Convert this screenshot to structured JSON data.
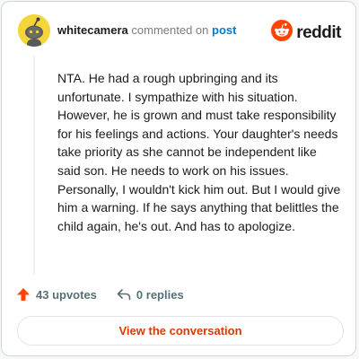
{
  "header": {
    "username": "whitecamera",
    "action_text": "commented on",
    "link_text": "post",
    "brand_name": "reddit",
    "avatar_icon": "snoo-avatar-icon",
    "brand_icon": "reddit-logo-icon"
  },
  "comment": {
    "body": "NTA. He had a rough upbringing and its unfortunate. I sympathize with his situation. However, he is grown and must take responsibility for his feelings and actions. Your daughter's needs take priority as she cannot be independent like said son. He needs to work on his issues. Personally, I wouldn't kick him out. But I would give him a warning. If he says anything that belittles the child again, he's out. And has to apologize."
  },
  "footer": {
    "upvotes": "43 upvotes",
    "replies": "0 replies",
    "upvote_icon": "upvote-arrow-icon",
    "reply_icon": "reply-arrow-icon"
  },
  "cta": {
    "label": "View the conversation"
  },
  "colors": {
    "accent": "#ff4500",
    "link": "#0079d3",
    "cta_text": "#d93a00",
    "avatar_bg": "#f5d63a"
  }
}
